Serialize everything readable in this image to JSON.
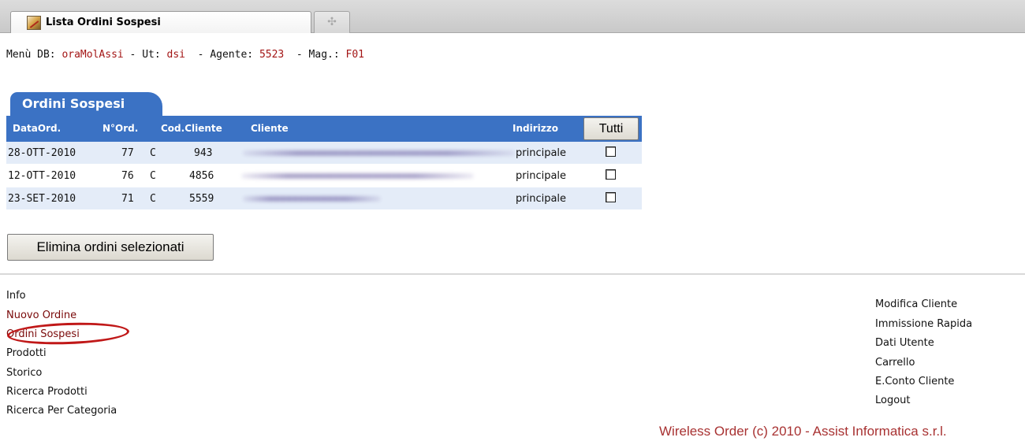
{
  "browser": {
    "tab_title": "Lista Ordini Sospesi",
    "new_tab_glyph": "✣"
  },
  "info": {
    "db_label": "Menù DB: ",
    "db_value": "oraMolAssi",
    "user_label": " - Ut: ",
    "user_value": "dsi",
    "agent_label": "  - Agente: ",
    "agent_value": "5523",
    "mag_label": "  - Mag.: ",
    "mag_value": "F01"
  },
  "panel": {
    "title": "Ordini Sospesi",
    "headers": {
      "data_ord": "DataOrd.",
      "num_ord": "N°Ord.",
      "cod_cliente": "Cod.Cliente",
      "cliente": "Cliente",
      "indirizzo": "Indirizzo"
    },
    "select_all_label": "Tutti",
    "rows": [
      {
        "date": "28-OTT-2010",
        "num": "77",
        "type": "C",
        "code": "943",
        "address": "principale",
        "checked": false
      },
      {
        "date": "12-OTT-2010",
        "num": "76",
        "type": "C",
        "code": "4856",
        "address": "principale",
        "checked": false
      },
      {
        "date": "23-SET-2010",
        "num": "71",
        "type": "C",
        "code": "5559",
        "address": "principale",
        "checked": false
      }
    ]
  },
  "delete_button": "Elimina ordini selezionati",
  "nav_left": [
    "Info",
    "Nuovo Ordine",
    "Ordini Sospesi",
    "Prodotti",
    "Storico",
    "Ricerca Prodotti",
    "Ricerca Per Categoria"
  ],
  "nav_right": [
    "Modifica Cliente",
    "Immissione Rapida",
    "Dati Utente",
    "Carrello",
    "E.Conto Cliente",
    "Logout"
  ],
  "footer": "Wireless Order (c) 2010 - Assist Informatica s.r.l.",
  "colors": {
    "header_blue": "#3b72c4",
    "row_stripe": "#e4ecf8",
    "value_red": "#a31515",
    "highlight_circle": "#c01818"
  }
}
